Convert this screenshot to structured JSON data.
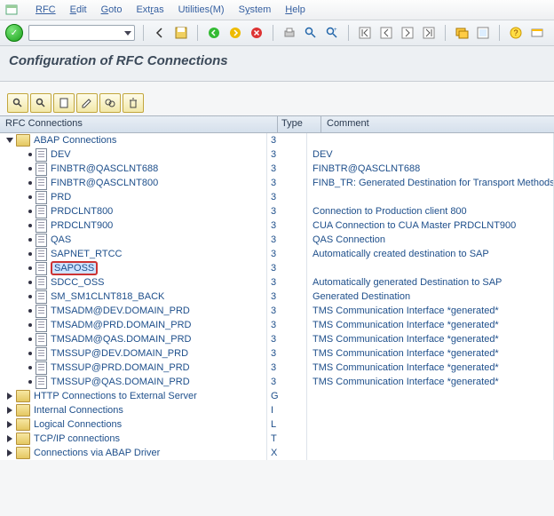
{
  "menu": {
    "items": [
      "RFC",
      "Edit",
      "Goto",
      "Extras",
      "Utilities(M)",
      "System",
      "Help"
    ]
  },
  "title": "Configuration of RFC Connections",
  "columns": {
    "name": "RFC Connections",
    "type": "Type",
    "comment": "Comment"
  },
  "root": {
    "label": "ABAP Connections",
    "type": "3",
    "comment": ""
  },
  "items": [
    {
      "label": "DEV",
      "type": "3",
      "comment": "DEV"
    },
    {
      "label": "FINBTR@QASCLNT688",
      "type": "3",
      "comment": "FINBTR@QASCLNT688"
    },
    {
      "label": "FINBTR@QASCLNT800",
      "type": "3",
      "comment": "FINB_TR: Generated Destination for Transport Methods"
    },
    {
      "label": "PRD",
      "type": "3",
      "comment": ""
    },
    {
      "label": "PRDCLNT800",
      "type": "3",
      "comment": "Connection to Production client 800"
    },
    {
      "label": "PRDCLNT900",
      "type": "3",
      "comment": "CUA Connection to CUA Master PRDCLNT900"
    },
    {
      "label": "QAS",
      "type": "3",
      "comment": "QAS Connection"
    },
    {
      "label": "SAPNET_RTCC",
      "type": "3",
      "comment": "Automatically created destination to SAP"
    },
    {
      "label": "SAPOSS",
      "type": "3",
      "comment": ""
    },
    {
      "label": "SDCC_OSS",
      "type": "3",
      "comment": "Automatically generated Destination to SAP"
    },
    {
      "label": "SM_SM1CLNT818_BACK",
      "type": "3",
      "comment": "Generated Destination"
    },
    {
      "label": "TMSADM@DEV.DOMAIN_PRD",
      "type": "3",
      "comment": "TMS Communication Interface  *generated*"
    },
    {
      "label": "TMSADM@PRD.DOMAIN_PRD",
      "type": "3",
      "comment": "TMS Communication Interface  *generated*"
    },
    {
      "label": "TMSADM@QAS.DOMAIN_PRD",
      "type": "3",
      "comment": "TMS Communication Interface  *generated*"
    },
    {
      "label": "TMSSUP@DEV.DOMAIN_PRD",
      "type": "3",
      "comment": "TMS Communication Interface  *generated*"
    },
    {
      "label": "TMSSUP@PRD.DOMAIN_PRD",
      "type": "3",
      "comment": "TMS Communication Interface  *generated*"
    },
    {
      "label": "TMSSUP@QAS.DOMAIN_PRD",
      "type": "3",
      "comment": "TMS Communication Interface  *generated*"
    }
  ],
  "folders": [
    {
      "label": "HTTP Connections to External Server",
      "type": "G"
    },
    {
      "label": "Internal Connections",
      "type": "I"
    },
    {
      "label": "Logical Connections",
      "type": "L"
    },
    {
      "label": "TCP/IP connections",
      "type": "T"
    },
    {
      "label": "Connections via ABAP Driver",
      "type": "X"
    }
  ],
  "selected_index": 8
}
